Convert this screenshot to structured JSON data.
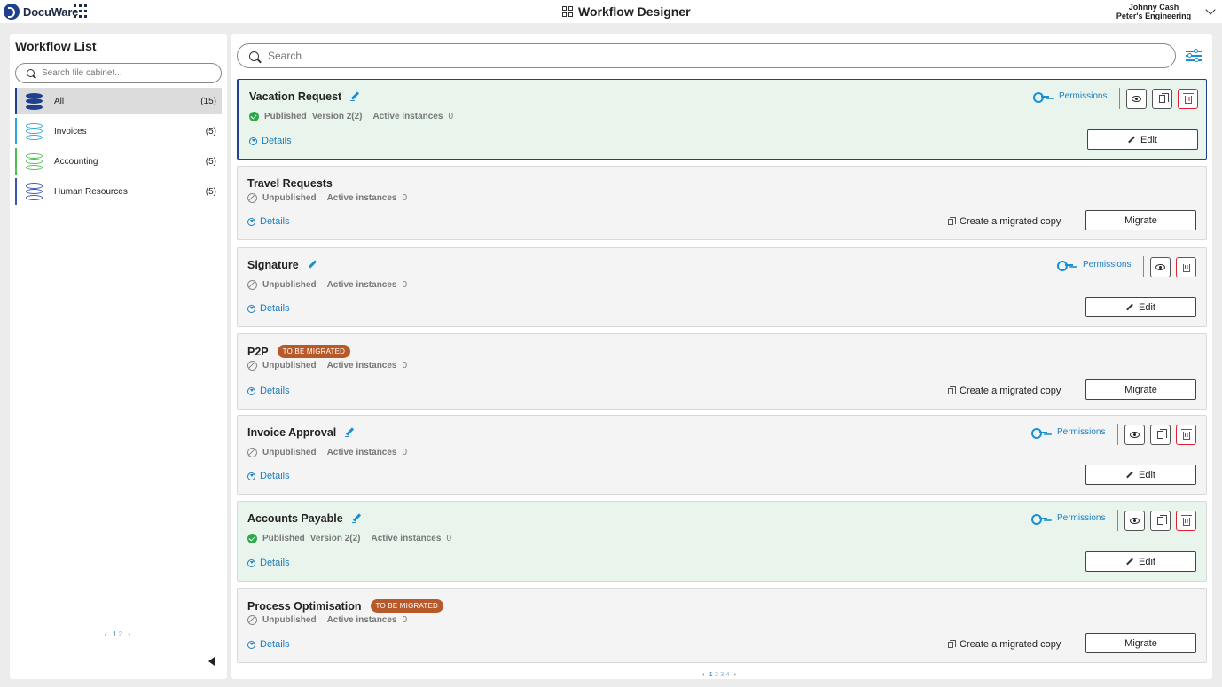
{
  "header": {
    "brand": "DocuWare",
    "app_title": "Workflow Designer",
    "user_name": "Johnny Cash",
    "user_org": "Peter's Engineering"
  },
  "sidebar": {
    "title": "Workflow List",
    "search_placeholder": "Search file cabinet...",
    "cabinets": [
      {
        "label": "All",
        "count": "(15)",
        "color": "#1f3f8f"
      },
      {
        "label": "Invoices",
        "count": "(5)",
        "color": "#2aa7d9"
      },
      {
        "label": "Accounting",
        "count": "(5)",
        "color": "#4cbf4c"
      },
      {
        "label": "Human Resources",
        "count": "(5)",
        "color": "#3a55b5"
      }
    ],
    "pager": {
      "prev": "‹",
      "current": "1",
      "other": "2",
      "next": "›"
    }
  },
  "main": {
    "search_placeholder": "Search",
    "labels": {
      "details": "Details",
      "permissions": "Permissions",
      "published": "Published",
      "unpublished": "Unpublished",
      "active_instances": "Active instances",
      "edit": "Edit",
      "migrate": "Migrate",
      "create_migrated_copy": "Create a migrated copy",
      "to_be_migrated": "TO BE MIGRATED"
    },
    "workflows": [
      {
        "name": "Vacation Request",
        "status": "Published",
        "version": "Version 2(2)",
        "active_instances": "0"
      },
      {
        "name": "Travel Requests",
        "status": "Unpublished",
        "active_instances": "0"
      },
      {
        "name": "Signature",
        "status": "Unpublished",
        "active_instances": "0"
      },
      {
        "name": "P2P",
        "status": "Unpublished",
        "active_instances": "0",
        "badge": "TO BE MIGRATED"
      },
      {
        "name": "Invoice Approval",
        "status": "Unpublished",
        "active_instances": "0"
      },
      {
        "name": "Accounts Payable",
        "status": "Published",
        "version": "Version 2(2)",
        "active_instances": "0"
      },
      {
        "name": "Process Optimisation",
        "status": "Unpublished",
        "active_instances": "0",
        "badge": "TO BE MIGRATED"
      }
    ],
    "pager": {
      "prev": "‹",
      "current": "1",
      "pages": [
        "2",
        "3",
        "4"
      ],
      "next": "›"
    }
  },
  "colors": {
    "accent": "#1a8fd1",
    "brand": "#1f3f8f",
    "published_bg": "#e9f5ec",
    "badge": "#b8592a",
    "delete": "#dd2233"
  }
}
